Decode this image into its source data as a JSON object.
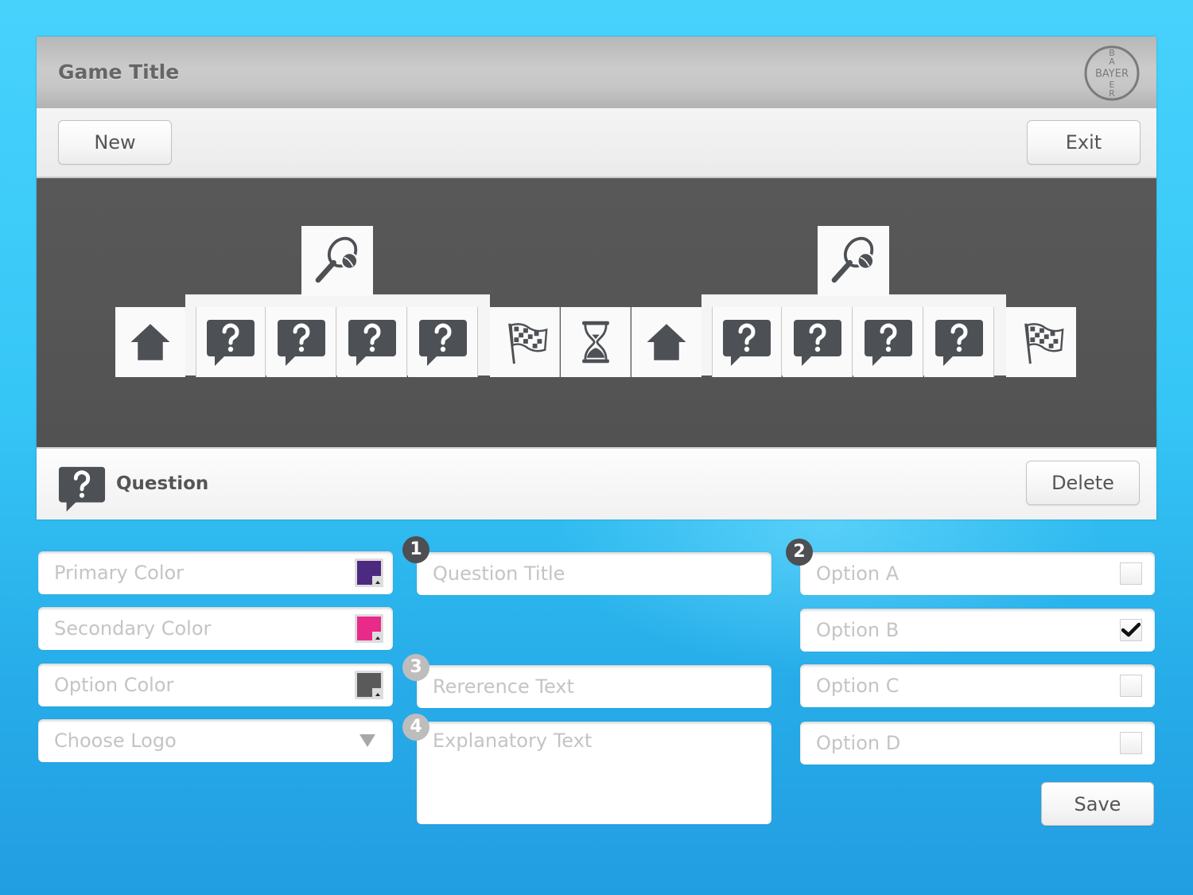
{
  "header": {
    "title": "Game Title",
    "logo_text": "BAYER",
    "logo_vertical": [
      "B",
      "A",
      "Y",
      "E",
      "R"
    ]
  },
  "toolbar": {
    "new_label": "New",
    "exit_label": "Exit"
  },
  "board": {
    "groups": [
      {
        "start_icon": "home-icon",
        "category_icon": "tennis-racket-icon",
        "question_tiles": [
          "question-bubble-icon",
          "question-bubble-icon",
          "question-bubble-icon",
          "question-bubble-icon"
        ],
        "end_icon": "checkered-flag-icon"
      },
      {
        "timer_icon": "hourglass-icon"
      },
      {
        "start_icon": "home-icon",
        "category_icon": "tennis-racket-icon",
        "question_tiles": [
          "question-bubble-icon",
          "question-bubble-icon",
          "question-bubble-icon",
          "question-bubble-icon"
        ],
        "end_icon": "checkered-flag-icon"
      }
    ]
  },
  "selection": {
    "icon": "question-bubble-icon",
    "label": "Question",
    "delete_label": "Delete"
  },
  "form": {
    "left": {
      "primary_color": {
        "placeholder": "Primary Color",
        "color": "#4b2a80"
      },
      "secondary_color": {
        "placeholder": "Secondary Color",
        "color": "#e92a8a"
      },
      "option_color": {
        "placeholder": "Option Color",
        "color": "#5a5a5a"
      },
      "logo": {
        "placeholder": "Choose Logo",
        "icon": "dropdown-arrow-icon"
      }
    },
    "middle": {
      "question_title": {
        "step": "1",
        "placeholder": "Question Title"
      },
      "reference_text": {
        "step": "3",
        "placeholder": "Rererence Text"
      },
      "explanatory_text": {
        "step": "4",
        "placeholder": "Explanatory Text"
      }
    },
    "right": {
      "step": "2",
      "options": [
        {
          "placeholder": "Option A",
          "checked": false
        },
        {
          "placeholder": "Option B",
          "checked": true
        },
        {
          "placeholder": "Option C",
          "checked": false
        },
        {
          "placeholder": "Option D",
          "checked": false
        }
      ],
      "save_label": "Save"
    }
  },
  "colors": {
    "accent_dark": "#4d4f52",
    "board_bg": "#555555",
    "background_blue": "#36c6f6"
  }
}
